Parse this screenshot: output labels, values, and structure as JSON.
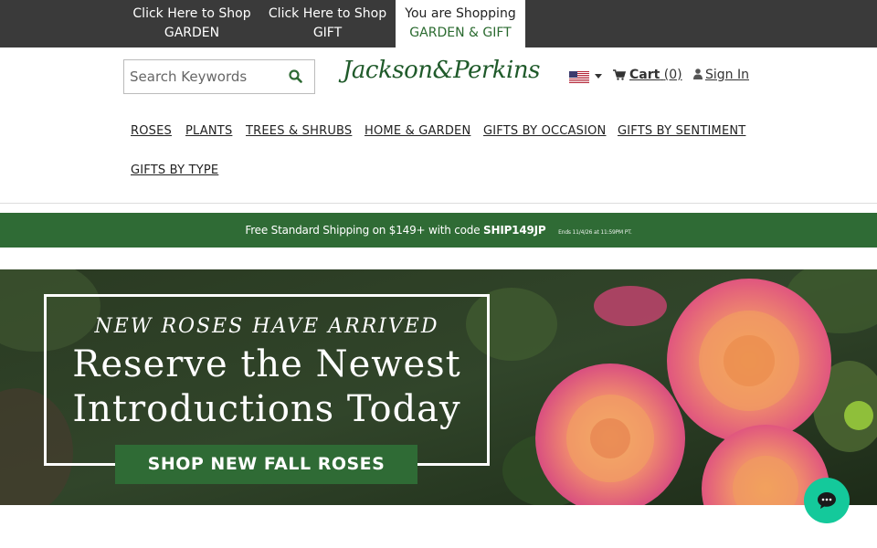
{
  "topbar": {
    "tabs": [
      {
        "line1": "Click Here to Shop",
        "line2": "GARDEN"
      },
      {
        "line1": "Click Here to Shop",
        "line2": "GIFT"
      },
      {
        "line1": "You are Shopping",
        "line2": "GARDEN & GIFT"
      }
    ]
  },
  "header": {
    "search_placeholder": "Search Keywords",
    "logo_text": "Jackson&Perkins",
    "cart_label": "Cart",
    "cart_count": "(0)",
    "signin_label": "Sign In"
  },
  "nav": {
    "items": [
      "ROSES",
      "PLANTS",
      "TREES & SHRUBS",
      "HOME & GARDEN",
      "GIFTS BY OCCASION",
      "GIFTS BY SENTIMENT",
      "GIFTS BY TYPE"
    ]
  },
  "promo": {
    "text": "Free Standard Shipping on $149+ with code",
    "code": "SHIP149JP",
    "fine_print": "Ends 11/4/26 at 11:59PM PT."
  },
  "hero": {
    "kicker": "NEW ROSES HAVE ARRIVED",
    "title_line1": "Reserve the Newest",
    "title_line2": "Introductions Today",
    "cta": "SHOP NEW FALL ROSES"
  },
  "colors": {
    "brand_green": "#2f6b35",
    "topbar_bg": "#3a3a3a",
    "chat_teal": "#14c99b"
  },
  "icons": {
    "search": "search-icon",
    "cart": "cart-icon",
    "user": "user-icon",
    "flag": "us-flag-icon",
    "chat": "chat-icon"
  }
}
